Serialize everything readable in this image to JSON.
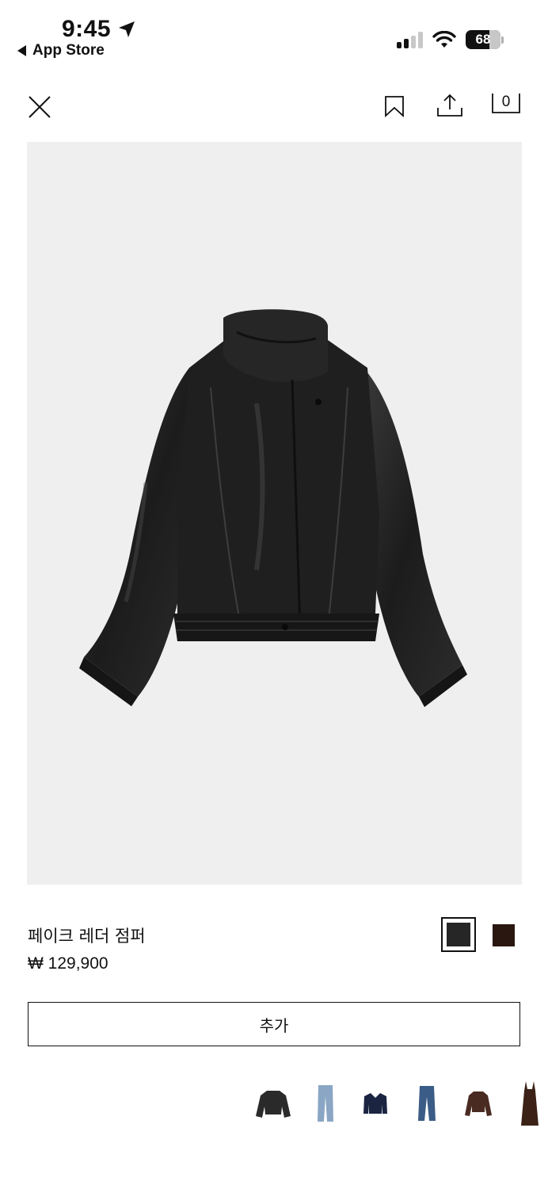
{
  "status_bar": {
    "time": "9:45",
    "back_label": "App Store",
    "battery": "68",
    "battery_level": 0.68
  },
  "header": {
    "close_icon": "close-icon",
    "save_icon": "bookmark-icon",
    "share_icon": "share-icon",
    "bag_count": "0"
  },
  "product": {
    "name": "페이크 레더 점퍼",
    "price": "₩ 129,900",
    "colors": [
      "#262626",
      "#2a1710"
    ],
    "selected_color_index": 0,
    "add_label": "추가"
  },
  "related": [
    {
      "icon": "jacket-thumb"
    },
    {
      "icon": "jeans-thumb"
    },
    {
      "icon": "sweater-thumb"
    },
    {
      "icon": "jeans-thumb"
    },
    {
      "icon": "jacket-thumb"
    },
    {
      "icon": "dress-thumb"
    }
  ]
}
